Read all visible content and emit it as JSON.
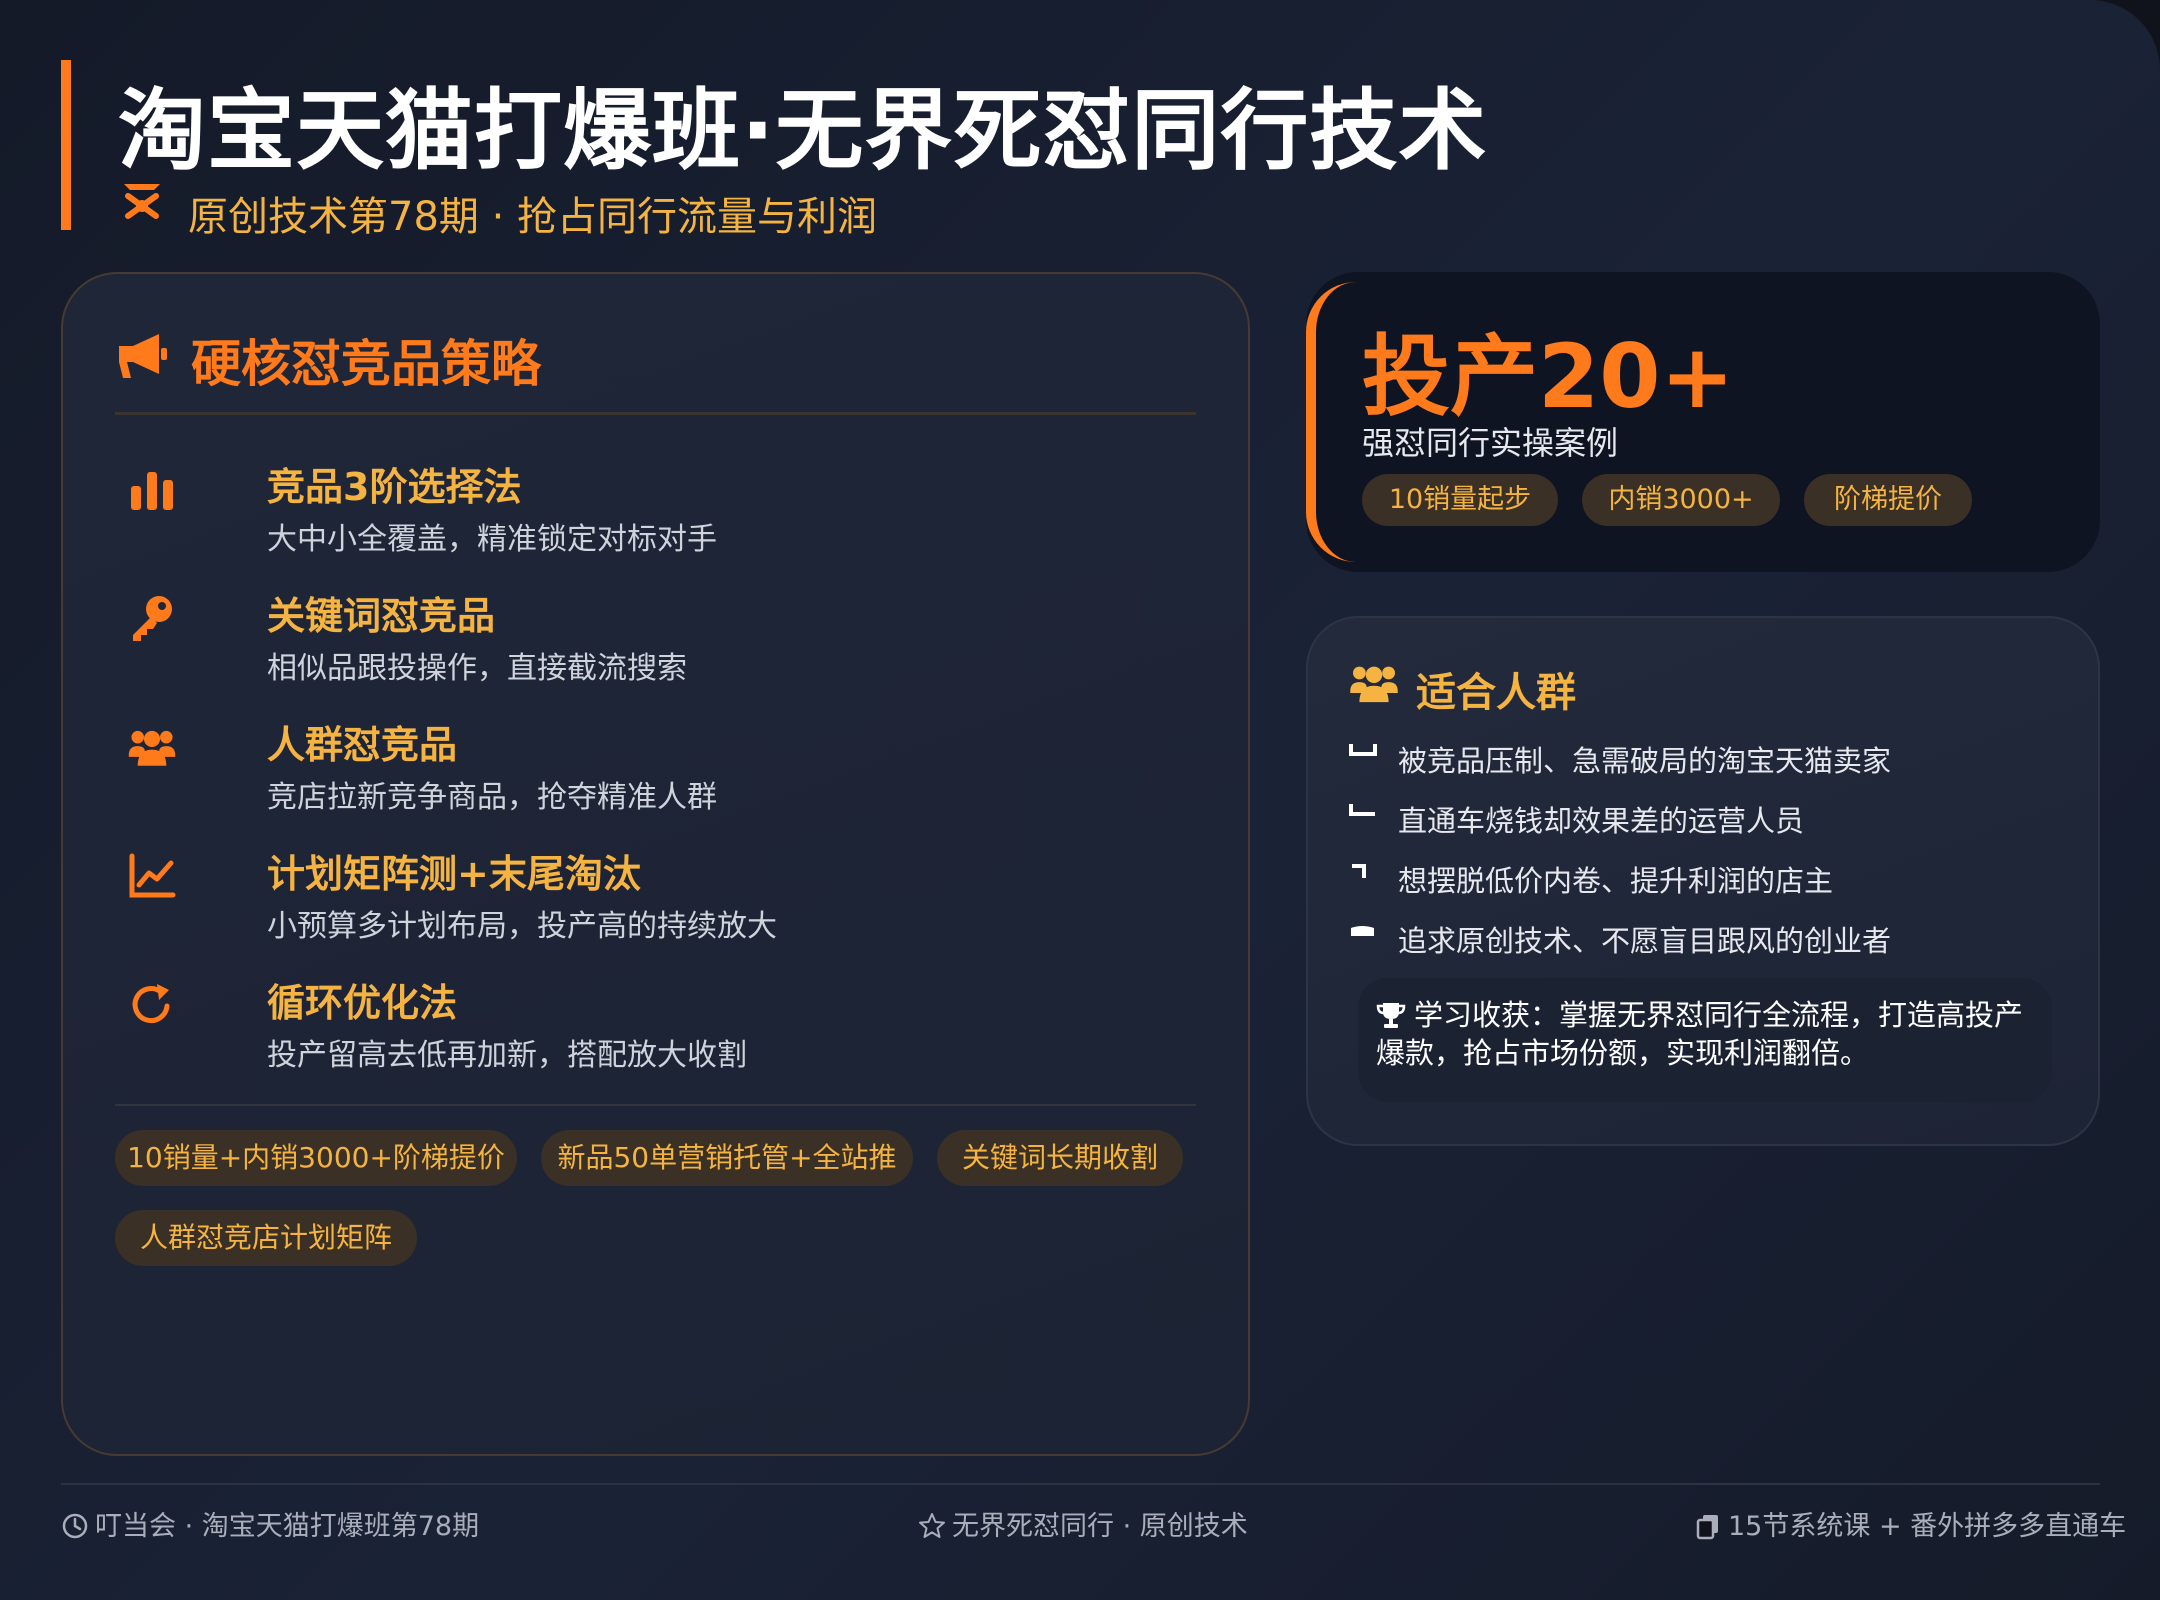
{
  "header": {
    "title": "淘宝天猫打爆班·无界死怼同行技术",
    "subtitle": "原创技术第78期 · 抢占同行流量与利润"
  },
  "strategy_panel": {
    "title": "硬核怼竞品策略",
    "items": [
      {
        "icon": "bar-chart-icon",
        "title": "竞品3阶选择法",
        "desc": "大中小全覆盖，精准锁定对标对手"
      },
      {
        "icon": "key-icon",
        "title": "关键词怼竞品",
        "desc": "相似品跟投操作，直接截流搜索"
      },
      {
        "icon": "users-icon",
        "title": "人群怼竞品",
        "desc": "竞店拉新竞争商品，抢夺精准人群"
      },
      {
        "icon": "line-chart-icon",
        "title": "计划矩阵测+末尾淘汰",
        "desc": "小预算多计划布局，投产高的持续放大"
      },
      {
        "icon": "refresh-icon",
        "title": "循环优化法",
        "desc": "投产留高去低再加新，搭配放大收割"
      }
    ],
    "tags": [
      "10销量+内销3000+阶梯提价",
      "新品50单营销托管+全站推",
      "关键词长期收割",
      "人群怼竞店计划矩阵"
    ]
  },
  "stat_card": {
    "value": "投产20+",
    "label": "强怼同行实操案例",
    "pills": [
      "10销量起步",
      "内销3000+",
      "阶梯提价"
    ]
  },
  "audience": {
    "title": "适合人群",
    "items": [
      "被竞品压制、急需破局的淘宝天猫卖家",
      "直通车烧钱却效果差的运营人员",
      "想摆脱低价内卷、提升利润的店主",
      "追求原创技术、不愿盲目跟风的创业者"
    ],
    "gain": "学习收获：掌握无界怼同行全流程，打造高投产爆款，抢占市场份额，实现利润翻倍。"
  },
  "footer": {
    "left": "叮当会 · 淘宝天猫打爆班第78期",
    "center": "无界死怼同行 · 原创技术",
    "right": "15节系统课 + 番外拼多多直通车"
  },
  "colors": {
    "accent": "#ff7a1a",
    "gold": "#f5b441",
    "background": "#141a28"
  }
}
